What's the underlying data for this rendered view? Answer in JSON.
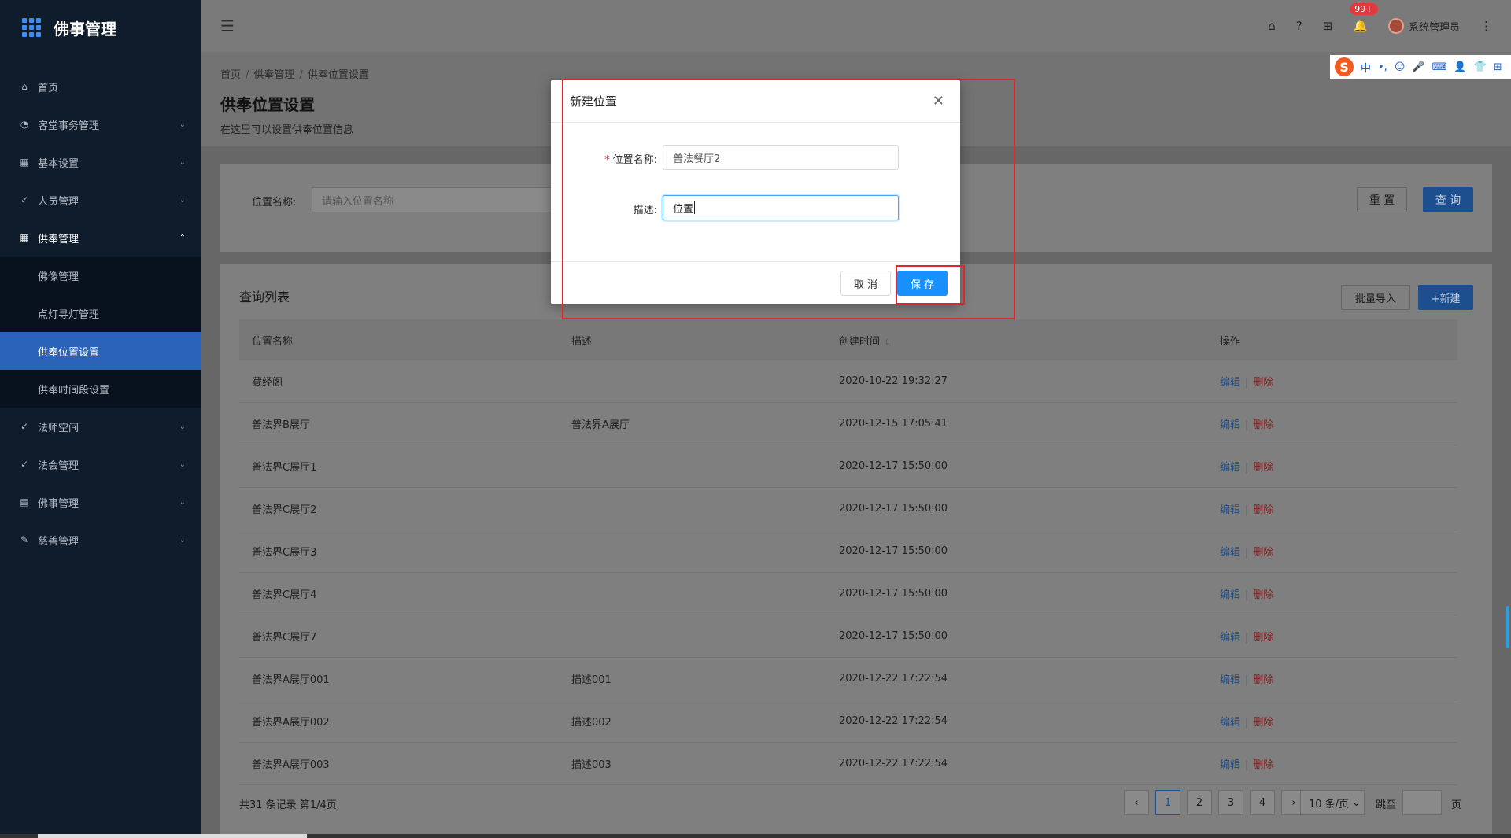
{
  "app": {
    "title": "佛事管理"
  },
  "sidebar": {
    "items": [
      {
        "label": "首页",
        "icon": "home-icon",
        "glyph": "⌂",
        "chevron": ""
      },
      {
        "label": "客堂事务管理",
        "icon": "dashboard-icon",
        "glyph": "◔",
        "chevron": "⌄"
      },
      {
        "label": "基本设置",
        "icon": "table-icon",
        "glyph": "▦",
        "chevron": "⌄"
      },
      {
        "label": "人员管理",
        "icon": "check-circle-icon",
        "glyph": "✓",
        "chevron": "⌄"
      },
      {
        "label": "供奉管理",
        "icon": "table-icon",
        "glyph": "▦",
        "chevron": "⌃"
      }
    ],
    "sub_items": [
      {
        "label": "佛像管理"
      },
      {
        "label": "点灯寻灯管理"
      },
      {
        "label": "供奉位置设置"
      },
      {
        "label": "供奉时间段设置"
      }
    ],
    "items_after": [
      {
        "label": "法师空间",
        "icon": "check-circle-icon",
        "glyph": "✓",
        "chevron": "⌄"
      },
      {
        "label": "法会管理",
        "icon": "check-circle-icon",
        "glyph": "✓",
        "chevron": "⌄"
      },
      {
        "label": "佛事管理",
        "icon": "document-icon",
        "glyph": "▤",
        "chevron": "⌄"
      },
      {
        "label": "慈善管理",
        "icon": "edit-icon",
        "glyph": "✎",
        "chevron": "⌄"
      }
    ]
  },
  "header": {
    "menu_glyph": "☰",
    "home_glyph": "⌂",
    "help_glyph": "?",
    "apps_glyph": "⊞",
    "bell_glyph": "🔔",
    "more_glyph": "⋮",
    "badge": "99+",
    "user_name": "系统管理员"
  },
  "ime": {
    "logo": "S",
    "lang": "中",
    "punct": "•,",
    "emoji": "☺",
    "voice": "🎤",
    "keyboard": "⌨",
    "user": "👤",
    "skin": "👕",
    "tools": "⊞"
  },
  "breadcrumb": [
    "首页",
    "供奉管理",
    "供奉位置设置"
  ],
  "breadcrumb_sep": "/",
  "page": {
    "title": "供奉位置设置",
    "subtitle": "在这里可以设置供奉位置信息"
  },
  "search": {
    "label": "位置名称:",
    "placeholder": "请输入位置名称",
    "reset_label": "重 置",
    "query_label": "查 询"
  },
  "list": {
    "title": "查询列表",
    "import_label": "批量导入",
    "new_label": "+新建",
    "columns": [
      "位置名称",
      "描述",
      "创建时间",
      "操作"
    ],
    "sort_glyph": "⇳",
    "edit_label": "编辑",
    "op_sep": "|",
    "delete_label": "删除",
    "rows": [
      {
        "name": "藏经阁",
        "desc": "",
        "time": "2020-10-22 19:32:27"
      },
      {
        "name": "普法界B展厅",
        "desc": "普法界A展厅",
        "time": "2020-12-15 17:05:41"
      },
      {
        "name": "普法界C展厅1",
        "desc": "",
        "time": "2020-12-17 15:50:00"
      },
      {
        "name": "普法界C展厅2",
        "desc": "",
        "time": "2020-12-17 15:50:00"
      },
      {
        "name": "普法界C展厅3",
        "desc": "",
        "time": "2020-12-17 15:50:00"
      },
      {
        "name": "普法界C展厅4",
        "desc": "",
        "time": "2020-12-17 15:50:00"
      },
      {
        "name": "普法界C展厅7",
        "desc": "",
        "time": "2020-12-17 15:50:00"
      },
      {
        "name": "普法界A展厅001",
        "desc": "描述001",
        "time": "2020-12-22 17:22:54"
      },
      {
        "name": "普法界A展厅002",
        "desc": "描述002",
        "time": "2020-12-22 17:22:54"
      },
      {
        "name": "普法界A展厅003",
        "desc": "描述003",
        "time": "2020-12-22 17:22:54"
      }
    ]
  },
  "pagination": {
    "total": "共31 条记录 第1/4页",
    "prev": "‹",
    "pages": [
      "1",
      "2",
      "3",
      "4"
    ],
    "next": "›",
    "size": "10 条/页",
    "size_arrow": "⌄",
    "jump_label": "跳至",
    "page_label": "页"
  },
  "modal": {
    "title": "新建位置",
    "close_glyph": "✕",
    "required_mark": "*",
    "name_label": "位置名称:",
    "name_value": "普法餐厅2",
    "desc_label": "描述:",
    "desc_value": "位置",
    "cancel_label": "取 消",
    "save_label": "保 存"
  },
  "colors": {
    "primary": "#1890ff",
    "sidebar_bg": "#0f1c2c",
    "active_menu": "#2b63b8",
    "highlight": "#e0252b",
    "danger": "#f5222d"
  }
}
